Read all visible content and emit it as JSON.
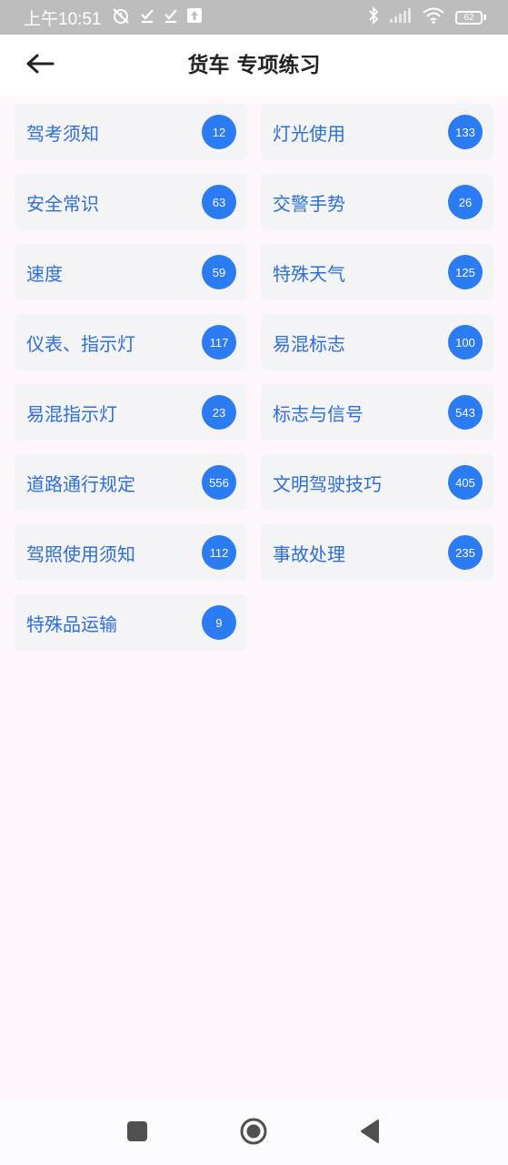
{
  "status_bar": {
    "time": "上午10:51",
    "battery": "62",
    "icons": [
      "alarm-off-icon",
      "check-icon",
      "check-icon",
      "upload-icon",
      "bluetooth-icon",
      "signal-icon",
      "wifi-icon",
      "battery-icon"
    ]
  },
  "header": {
    "title": "货车 专项练习",
    "back_icon": "arrow-left-icon"
  },
  "categories": [
    {
      "label": "驾考须知",
      "count": "12"
    },
    {
      "label": "灯光使用",
      "count": "133"
    },
    {
      "label": "安全常识",
      "count": "63"
    },
    {
      "label": "交警手势",
      "count": "26"
    },
    {
      "label": "速度",
      "count": "59"
    },
    {
      "label": "特殊天气",
      "count": "125"
    },
    {
      "label": "仪表、指示灯",
      "count": "117"
    },
    {
      "label": "易混标志",
      "count": "100"
    },
    {
      "label": "易混指示灯",
      "count": "23"
    },
    {
      "label": "标志与信号",
      "count": "543"
    },
    {
      "label": "道路通行规定",
      "count": "556"
    },
    {
      "label": "文明驾驶技巧",
      "count": "405"
    },
    {
      "label": "驾照使用须知",
      "count": "112"
    },
    {
      "label": "事故处理",
      "count": "235"
    },
    {
      "label": "特殊品运输",
      "count": "9"
    }
  ],
  "nav_bar": {
    "icons": [
      "recents-square-icon",
      "home-circle-icon",
      "back-triangle-icon"
    ]
  },
  "colors": {
    "accent": "#2b7bf3",
    "label": "#2d6fd8",
    "card_bg": "#f4f3f6",
    "page_bg": "#fdf7fb",
    "status_bar_bg": "#bdbdbd"
  }
}
